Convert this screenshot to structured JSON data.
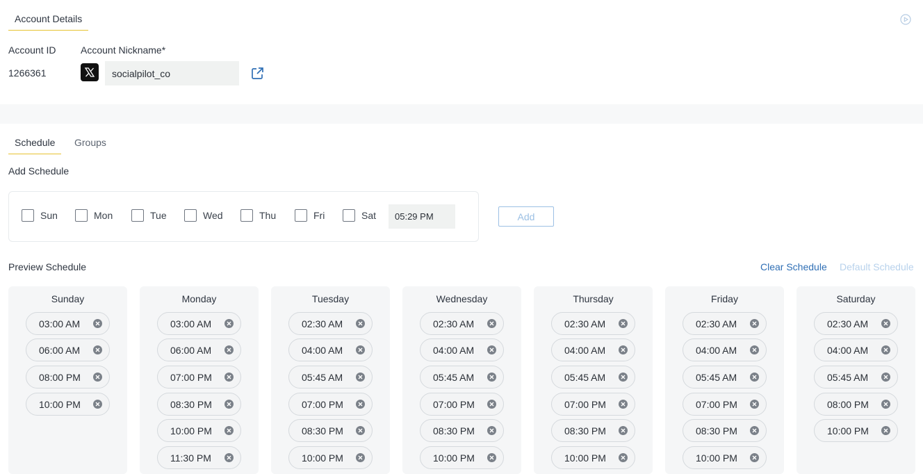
{
  "account": {
    "tab_label": "Account Details",
    "id_label": "Account ID",
    "id_value": "1266361",
    "nickname_label": "Account Nickname*",
    "nickname_value": "socialpilot_co"
  },
  "tabs": {
    "schedule": "Schedule",
    "groups": "Groups"
  },
  "add_schedule": {
    "title": "Add Schedule",
    "days": [
      "Sun",
      "Mon",
      "Tue",
      "Wed",
      "Thu",
      "Fri",
      "Sat"
    ],
    "time_value": "05:29 PM",
    "add_label": "Add"
  },
  "preview": {
    "title": "Preview Schedule",
    "clear_label": "Clear Schedule",
    "default_label": "Default Schedule",
    "days": [
      {
        "name": "Sunday",
        "slots": [
          "03:00 AM",
          "06:00 AM",
          "08:00 PM",
          "10:00 PM"
        ]
      },
      {
        "name": "Monday",
        "slots": [
          "03:00 AM",
          "06:00 AM",
          "07:00 PM",
          "08:30 PM",
          "10:00 PM",
          "11:30 PM"
        ]
      },
      {
        "name": "Tuesday",
        "slots": [
          "02:30 AM",
          "04:00 AM",
          "05:45 AM",
          "07:00 PM",
          "08:30 PM",
          "10:00 PM"
        ]
      },
      {
        "name": "Wednesday",
        "slots": [
          "02:30 AM",
          "04:00 AM",
          "05:45 AM",
          "07:00 PM",
          "08:30 PM",
          "10:00 PM"
        ]
      },
      {
        "name": "Thursday",
        "slots": [
          "02:30 AM",
          "04:00 AM",
          "05:45 AM",
          "07:00 PM",
          "08:30 PM",
          "10:00 PM"
        ]
      },
      {
        "name": "Friday",
        "slots": [
          "02:30 AM",
          "04:00 AM",
          "05:45 AM",
          "07:00 PM",
          "08:30 PM",
          "10:00 PM"
        ]
      },
      {
        "name": "Saturday",
        "slots": [
          "02:30 AM",
          "04:00 AM",
          "05:45 AM",
          "08:00 PM",
          "10:00 PM"
        ]
      }
    ]
  },
  "colors": {
    "accent_tab": "#e6c230",
    "link": "#2f6fb5",
    "link_disabled": "#b8d2ec"
  }
}
